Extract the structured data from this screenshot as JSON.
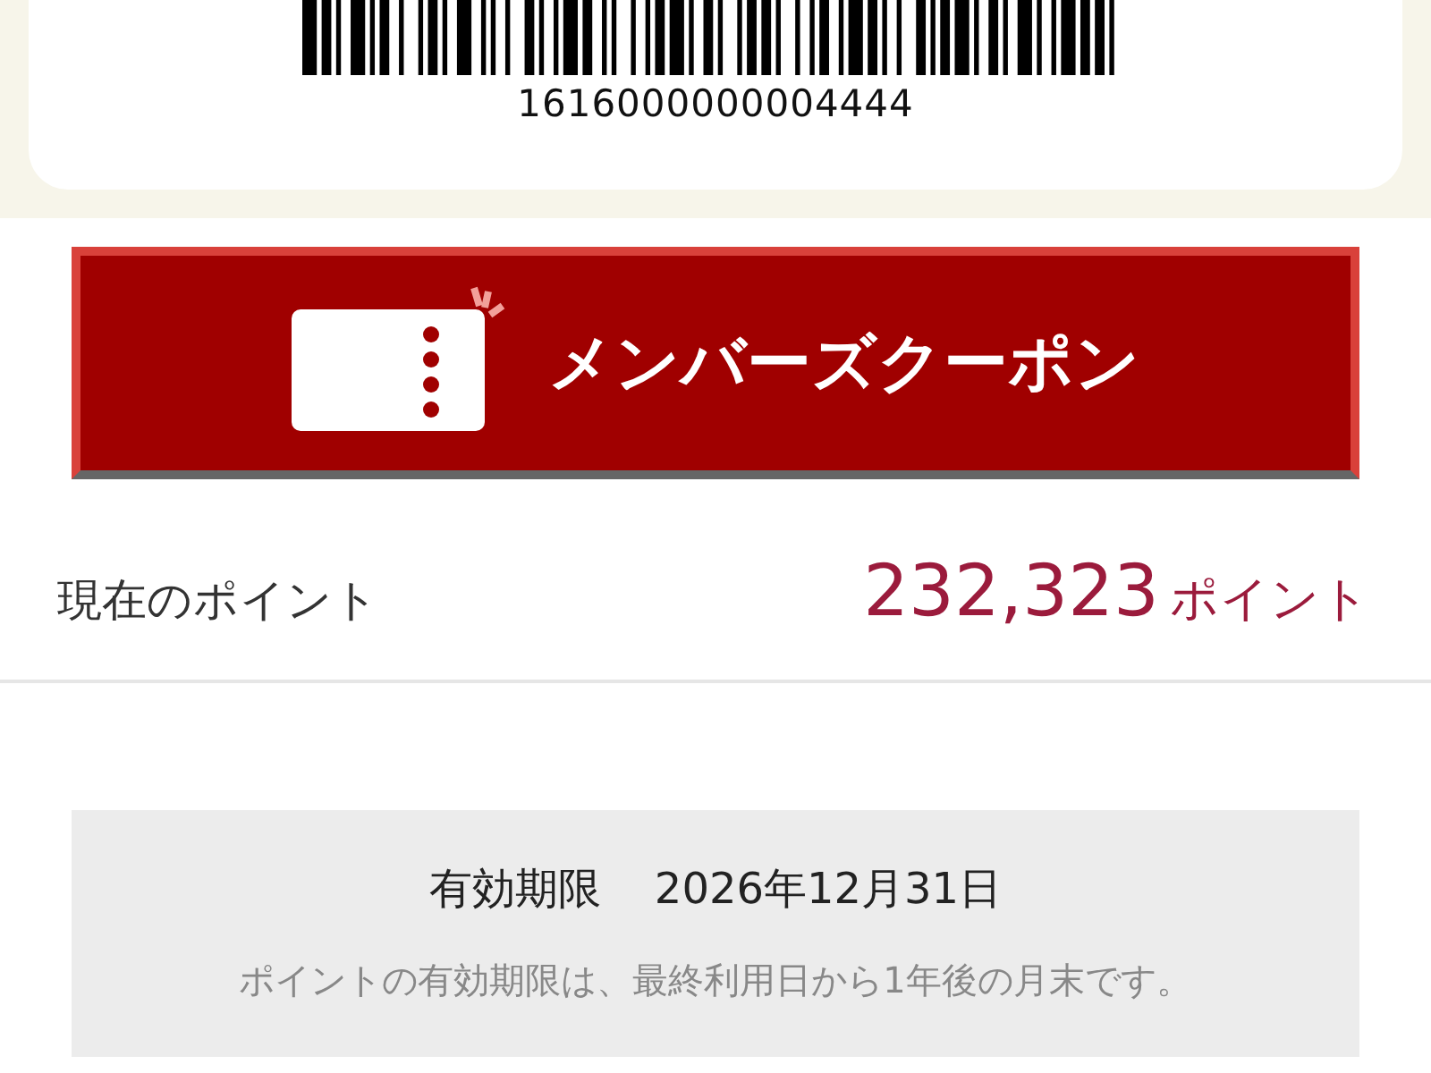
{
  "member_card": {
    "barcode_number": "1616000000004444"
  },
  "coupon_button": {
    "label": "メンバーズクーポン"
  },
  "points": {
    "label": "現在のポイント",
    "value": "232,323",
    "unit": "ポイント"
  },
  "expiry": {
    "label": "有効期限",
    "date": "2026年12月31日",
    "note": "ポイントの有効期限は、最終利用日から1年後の月末です。"
  }
}
